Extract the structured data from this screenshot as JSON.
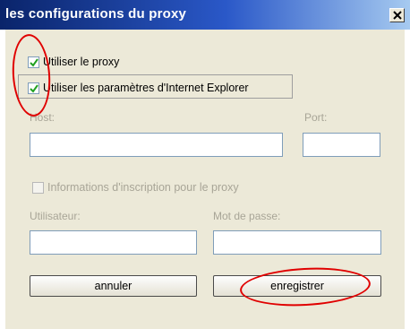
{
  "window": {
    "title": "les configurations du proxy"
  },
  "checkboxes": {
    "use_proxy": {
      "label": "Utiliser le proxy",
      "checked": true
    },
    "use_ie_settings": {
      "label": "Utiliser les paramètres d'Internet Explorer",
      "checked": true
    },
    "proxy_credentials": {
      "label": "Informations d'inscription pour le proxy",
      "checked": false
    }
  },
  "fields": {
    "host": {
      "label": "Host:",
      "value": ""
    },
    "port": {
      "label": "Port:",
      "value": ""
    },
    "user": {
      "label": "Utilisateur:",
      "value": ""
    },
    "password": {
      "label": "Mot de passe:",
      "value": ""
    }
  },
  "buttons": {
    "cancel": "annuler",
    "save": "enregistrer"
  },
  "colors": {
    "annotation": "#e00000",
    "title_bar": "#0a246a",
    "dialog_bg": "#ece9d8"
  }
}
